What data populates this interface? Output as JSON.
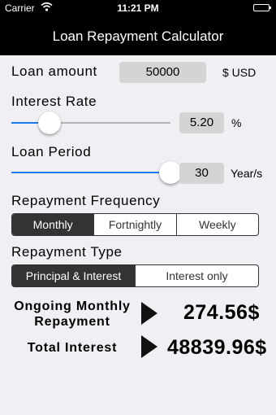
{
  "status_bar": {
    "carrier": "Carrier",
    "time": "11:21 PM"
  },
  "nav": {
    "title": "Loan Repayment Calculator"
  },
  "loan_amount": {
    "label": "Loan amount",
    "value": "50000",
    "unit": "$ USD"
  },
  "interest_rate": {
    "label": "Interest Rate",
    "value": "5.20",
    "unit": "%",
    "slider_fraction": 0.24
  },
  "loan_period": {
    "label": "Loan Period",
    "value": "30",
    "unit": "Year/s",
    "slider_fraction": 1.0
  },
  "repayment_frequency": {
    "label": "Repayment Frequency",
    "options": [
      "Monthly",
      "Fortnightly",
      "Weekly"
    ],
    "selected": "Monthly"
  },
  "repayment_type": {
    "label": "Repayment Type",
    "options": [
      "Principal & Interest",
      "Interest only"
    ],
    "selected": "Principal & Interest"
  },
  "results": {
    "monthly_label_line1": "Ongoing Monthly",
    "monthly_label_line2": "Repayment",
    "monthly_value": "274.56$",
    "total_label": "Total Interest",
    "total_value": "48839.96$"
  },
  "icons": {
    "wifi": "wifi-icon",
    "battery": "battery-icon",
    "arrow": "play-arrow-icon"
  },
  "colors": {
    "slider_accent": "#1a7cf2",
    "nav_bg": "#000000",
    "segment_selected": "#333333"
  }
}
